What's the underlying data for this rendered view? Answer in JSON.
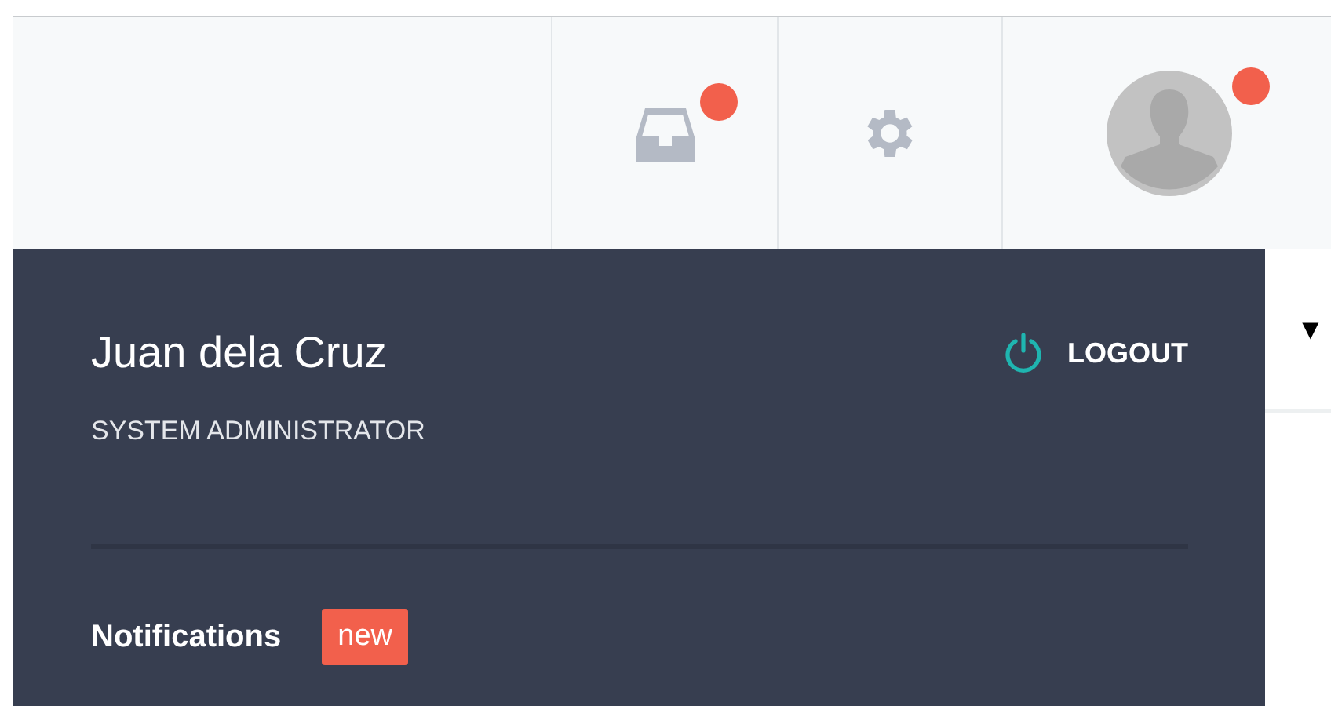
{
  "toolbar": {
    "items": [
      {
        "kind": "inbox",
        "alert": true
      },
      {
        "kind": "settings",
        "alert": false
      },
      {
        "kind": "avatar",
        "alert": true
      }
    ]
  },
  "user_panel": {
    "name": "Juan dela Cruz",
    "role": "SYSTEM ADMINISTRATOR",
    "logout": "LOGOUT",
    "notifications": {
      "title": "Notifications",
      "badge": "new"
    }
  },
  "dropdown_caret": "▼"
}
